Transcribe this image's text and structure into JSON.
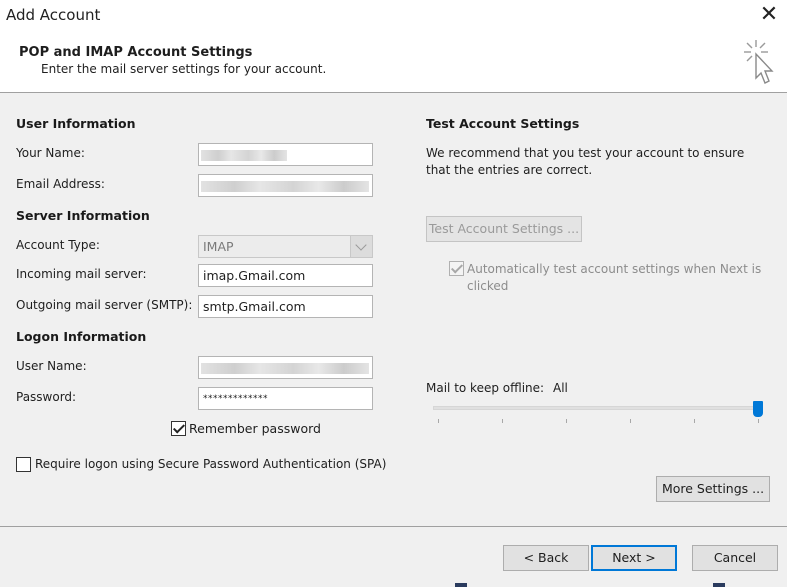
{
  "window": {
    "title": "Add Account",
    "close_glyph": "✕"
  },
  "header": {
    "title": "POP and IMAP Account Settings",
    "subtitle": "Enter the mail server settings for your account.",
    "icon": "cursor-sparkle-icon"
  },
  "user_info": {
    "heading": "User Information",
    "name_label": "Your Name:",
    "name_value": "",
    "email_label": "Email Address:",
    "email_value": ""
  },
  "server_info": {
    "heading": "Server Information",
    "account_type_label": "Account Type:",
    "account_type_value": "IMAP",
    "incoming_label": "Incoming mail server:",
    "incoming_value": "imap.Gmail.com",
    "outgoing_label": "Outgoing mail server (SMTP):",
    "outgoing_value": "smtp.Gmail.com"
  },
  "logon_info": {
    "heading": "Logon Information",
    "username_label": "User Name:",
    "username_value": "",
    "password_label": "Password:",
    "password_value": "*************",
    "remember_label": "Remember password",
    "remember_checked": true,
    "spa_label": "Require logon using Secure Password Authentication (SPA)",
    "spa_checked": false
  },
  "test_settings": {
    "heading": "Test Account Settings",
    "description": "We recommend that you test your account to ensure that the entries are correct.",
    "button_label": "Test Account Settings ...",
    "auto_test_label": "Automatically test account settings when Next is clicked",
    "auto_test_checked": true
  },
  "offline": {
    "label": "Mail to keep offline:",
    "value": "All",
    "slider_level": 1.0
  },
  "buttons": {
    "more_settings": "More Settings ...",
    "back": "< Back",
    "next": "Next >",
    "cancel": "Cancel"
  },
  "colors": {
    "accent": "#0078d7",
    "panel": "#f0f0f0"
  }
}
